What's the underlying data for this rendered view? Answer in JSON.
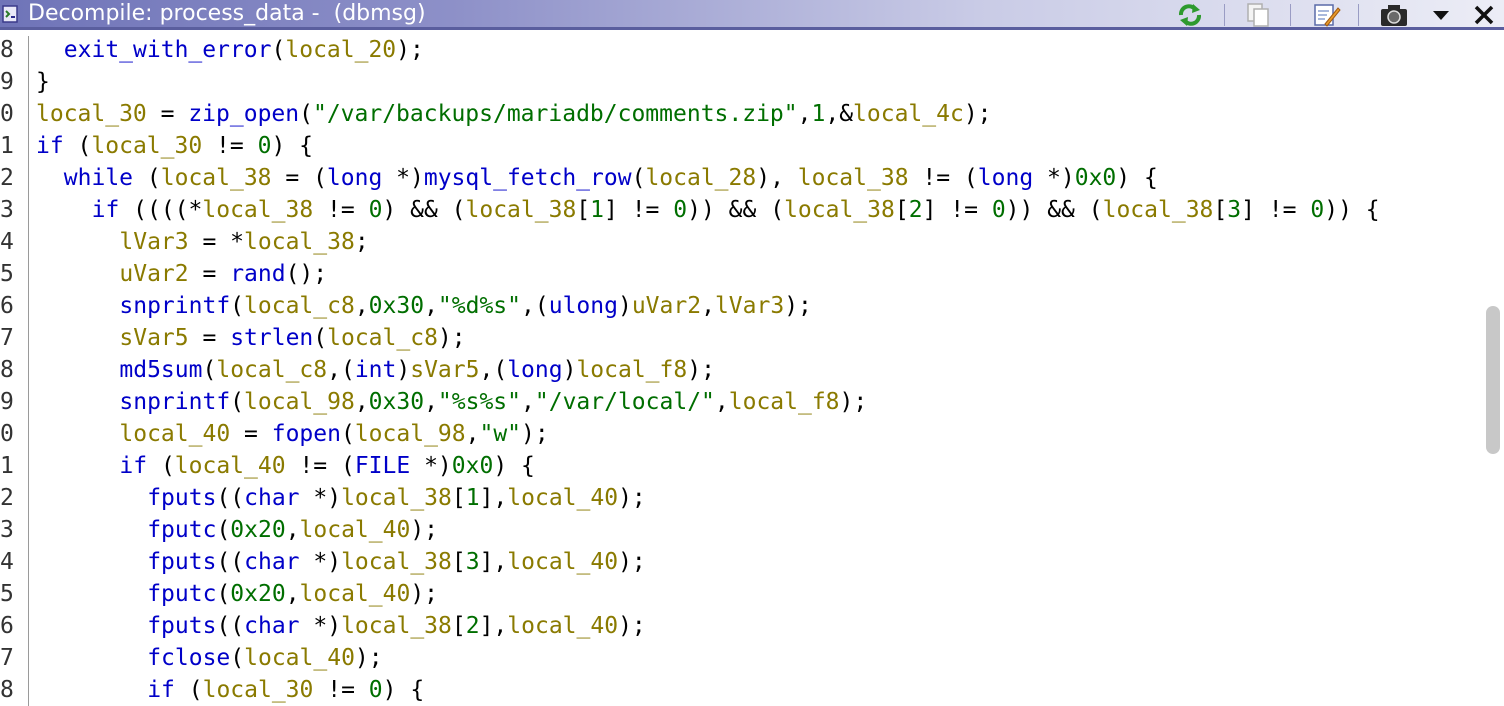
{
  "window": {
    "title": "Decompile: process_data -  (dbmsg)"
  },
  "toolbar": {
    "buttons": [
      {
        "name": "refresh-icon"
      },
      {
        "name": "copy-icon"
      },
      {
        "name": "edit-icon"
      },
      {
        "name": "snapshot-icon"
      },
      {
        "name": "menu-dropdown-icon"
      },
      {
        "name": "close-icon"
      }
    ]
  },
  "code": {
    "lines": [
      {
        "num": "8",
        "indent": 2,
        "tokens": [
          [
            "f",
            "exit_with_error"
          ],
          [
            "p",
            "("
          ],
          [
            "v",
            "local_20"
          ],
          [
            "p",
            ");"
          ]
        ]
      },
      {
        "num": "9",
        "indent": 1,
        "tokens": [
          [
            "p",
            "}"
          ]
        ]
      },
      {
        "num": "0",
        "indent": 1,
        "tokens": [
          [
            "v",
            "local_30"
          ],
          [
            "p",
            " = "
          ],
          [
            "f",
            "zip_open"
          ],
          [
            "p",
            "("
          ],
          [
            "s",
            "\"/var/backups/mariadb/comments.zip\""
          ],
          [
            "p",
            ","
          ],
          [
            "n",
            "1"
          ],
          [
            "p",
            ",&"
          ],
          [
            "v",
            "local_4c"
          ],
          [
            "p",
            ");"
          ]
        ]
      },
      {
        "num": "1",
        "indent": 1,
        "tokens": [
          [
            "k",
            "if"
          ],
          [
            "p",
            " ("
          ],
          [
            "v",
            "local_30"
          ],
          [
            "p",
            " != "
          ],
          [
            "n",
            "0"
          ],
          [
            "p",
            ") {"
          ]
        ]
      },
      {
        "num": "2",
        "indent": 2,
        "tokens": [
          [
            "k",
            "while"
          ],
          [
            "p",
            " ("
          ],
          [
            "v",
            "local_38"
          ],
          [
            "p",
            " = ("
          ],
          [
            "t",
            "long"
          ],
          [
            "p",
            " *)"
          ],
          [
            "f",
            "mysql_fetch_row"
          ],
          [
            "p",
            "("
          ],
          [
            "v",
            "local_28"
          ],
          [
            "p",
            "), "
          ],
          [
            "v",
            "local_38"
          ],
          [
            "p",
            " != ("
          ],
          [
            "t",
            "long"
          ],
          [
            "p",
            " *)"
          ],
          [
            "n",
            "0x0"
          ],
          [
            "p",
            ") {"
          ]
        ]
      },
      {
        "num": "3",
        "indent": 3,
        "tokens": [
          [
            "k",
            "if"
          ],
          [
            "p",
            " ((((*"
          ],
          [
            "v",
            "local_38"
          ],
          [
            "p",
            " != "
          ],
          [
            "n",
            "0"
          ],
          [
            "p",
            ") && ("
          ],
          [
            "v",
            "local_38"
          ],
          [
            "p",
            "["
          ],
          [
            "n",
            "1"
          ],
          [
            "p",
            "] != "
          ],
          [
            "n",
            "0"
          ],
          [
            "p",
            ")) && ("
          ],
          [
            "v",
            "local_38"
          ],
          [
            "p",
            "["
          ],
          [
            "n",
            "2"
          ],
          [
            "p",
            "] != "
          ],
          [
            "n",
            "0"
          ],
          [
            "p",
            ")) && ("
          ],
          [
            "v",
            "local_38"
          ],
          [
            "p",
            "["
          ],
          [
            "n",
            "3"
          ],
          [
            "p",
            "] != "
          ],
          [
            "n",
            "0"
          ],
          [
            "p",
            ")) {"
          ]
        ]
      },
      {
        "num": "4",
        "indent": 4,
        "tokens": [
          [
            "v",
            "lVar3"
          ],
          [
            "p",
            " = *"
          ],
          [
            "v",
            "local_38"
          ],
          [
            "p",
            ";"
          ]
        ]
      },
      {
        "num": "5",
        "indent": 4,
        "tokens": [
          [
            "v",
            "uVar2"
          ],
          [
            "p",
            " = "
          ],
          [
            "f",
            "rand"
          ],
          [
            "p",
            "();"
          ]
        ]
      },
      {
        "num": "6",
        "indent": 4,
        "tokens": [
          [
            "f",
            "snprintf"
          ],
          [
            "p",
            "("
          ],
          [
            "v",
            "local_c8"
          ],
          [
            "p",
            ","
          ],
          [
            "n",
            "0x30"
          ],
          [
            "p",
            ","
          ],
          [
            "s",
            "\"%d%s\""
          ],
          [
            "p",
            ",("
          ],
          [
            "t",
            "ulong"
          ],
          [
            "p",
            ")"
          ],
          [
            "v",
            "uVar2"
          ],
          [
            "p",
            ","
          ],
          [
            "v",
            "lVar3"
          ],
          [
            "p",
            ");"
          ]
        ]
      },
      {
        "num": "7",
        "indent": 4,
        "tokens": [
          [
            "v",
            "sVar5"
          ],
          [
            "p",
            " = "
          ],
          [
            "f",
            "strlen"
          ],
          [
            "p",
            "("
          ],
          [
            "v",
            "local_c8"
          ],
          [
            "p",
            ");"
          ]
        ]
      },
      {
        "num": "8",
        "indent": 4,
        "tokens": [
          [
            "f",
            "md5sum"
          ],
          [
            "p",
            "("
          ],
          [
            "v",
            "local_c8"
          ],
          [
            "p",
            ",("
          ],
          [
            "t",
            "int"
          ],
          [
            "p",
            ")"
          ],
          [
            "v",
            "sVar5"
          ],
          [
            "p",
            ",("
          ],
          [
            "t",
            "long"
          ],
          [
            "p",
            ")"
          ],
          [
            "v",
            "local_f8"
          ],
          [
            "p",
            ");"
          ]
        ]
      },
      {
        "num": "9",
        "indent": 4,
        "tokens": [
          [
            "f",
            "snprintf"
          ],
          [
            "p",
            "("
          ],
          [
            "v",
            "local_98"
          ],
          [
            "p",
            ","
          ],
          [
            "n",
            "0x30"
          ],
          [
            "p",
            ","
          ],
          [
            "s",
            "\"%s%s\""
          ],
          [
            "p",
            ","
          ],
          [
            "s",
            "\"/var/local/\""
          ],
          [
            "p",
            ","
          ],
          [
            "v",
            "local_f8"
          ],
          [
            "p",
            ");"
          ]
        ]
      },
      {
        "num": "0",
        "indent": 4,
        "tokens": [
          [
            "v",
            "local_40"
          ],
          [
            "p",
            " = "
          ],
          [
            "f",
            "fopen"
          ],
          [
            "p",
            "("
          ],
          [
            "v",
            "local_98"
          ],
          [
            "p",
            ","
          ],
          [
            "s",
            "\"w\""
          ],
          [
            "p",
            ");"
          ]
        ]
      },
      {
        "num": "1",
        "indent": 4,
        "tokens": [
          [
            "k",
            "if"
          ],
          [
            "p",
            " ("
          ],
          [
            "v",
            "local_40"
          ],
          [
            "p",
            " != ("
          ],
          [
            "t",
            "FILE"
          ],
          [
            "p",
            " *)"
          ],
          [
            "n",
            "0x0"
          ],
          [
            "p",
            ") {"
          ]
        ]
      },
      {
        "num": "2",
        "indent": 5,
        "tokens": [
          [
            "f",
            "fputs"
          ],
          [
            "p",
            "(("
          ],
          [
            "t",
            "char"
          ],
          [
            "p",
            " *)"
          ],
          [
            "v",
            "local_38"
          ],
          [
            "p",
            "["
          ],
          [
            "n",
            "1"
          ],
          [
            "p",
            "],"
          ],
          [
            "v",
            "local_40"
          ],
          [
            "p",
            ");"
          ]
        ]
      },
      {
        "num": "3",
        "indent": 5,
        "tokens": [
          [
            "f",
            "fputc"
          ],
          [
            "p",
            "("
          ],
          [
            "n",
            "0x20"
          ],
          [
            "p",
            ","
          ],
          [
            "v",
            "local_40"
          ],
          [
            "p",
            ");"
          ]
        ]
      },
      {
        "num": "4",
        "indent": 5,
        "tokens": [
          [
            "f",
            "fputs"
          ],
          [
            "p",
            "(("
          ],
          [
            "t",
            "char"
          ],
          [
            "p",
            " *)"
          ],
          [
            "v",
            "local_38"
          ],
          [
            "p",
            "["
          ],
          [
            "n",
            "3"
          ],
          [
            "p",
            "],"
          ],
          [
            "v",
            "local_40"
          ],
          [
            "p",
            ");"
          ]
        ]
      },
      {
        "num": "5",
        "indent": 5,
        "tokens": [
          [
            "f",
            "fputc"
          ],
          [
            "p",
            "("
          ],
          [
            "n",
            "0x20"
          ],
          [
            "p",
            ","
          ],
          [
            "v",
            "local_40"
          ],
          [
            "p",
            ");"
          ]
        ]
      },
      {
        "num": "6",
        "indent": 5,
        "tokens": [
          [
            "f",
            "fputs"
          ],
          [
            "p",
            "(("
          ],
          [
            "t",
            "char"
          ],
          [
            "p",
            " *)"
          ],
          [
            "v",
            "local_38"
          ],
          [
            "p",
            "["
          ],
          [
            "n",
            "2"
          ],
          [
            "p",
            "],"
          ],
          [
            "v",
            "local_40"
          ],
          [
            "p",
            ");"
          ]
        ]
      },
      {
        "num": "7",
        "indent": 5,
        "tokens": [
          [
            "f",
            "fclose"
          ],
          [
            "p",
            "("
          ],
          [
            "v",
            "local_40"
          ],
          [
            "p",
            ");"
          ]
        ]
      },
      {
        "num": "8",
        "indent": 5,
        "tokens": [
          [
            "k",
            "if"
          ],
          [
            "p",
            " ("
          ],
          [
            "v",
            "local_30"
          ],
          [
            "p",
            " != "
          ],
          [
            "n",
            "0"
          ],
          [
            "p",
            ") {"
          ]
        ]
      }
    ]
  }
}
